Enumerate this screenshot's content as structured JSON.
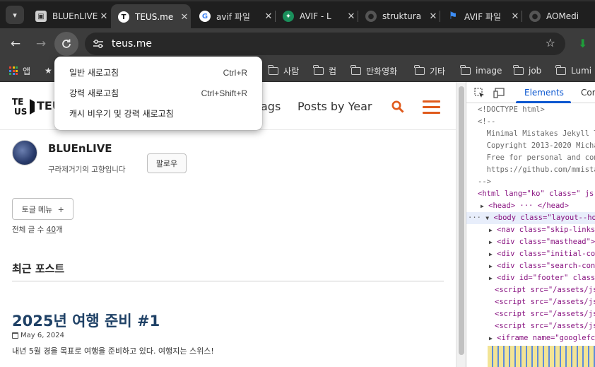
{
  "tabs": [
    {
      "title": "BLUEnLIVE",
      "favicon": "avatar-icon",
      "active": false
    },
    {
      "title": "TEUS.me",
      "favicon": "teus-icon",
      "active": true
    },
    {
      "title": "avif 파일",
      "favicon": "google-icon",
      "active": false
    },
    {
      "title": "AVIF - L",
      "favicon": "ai-icon",
      "active": false
    },
    {
      "title": "struktura",
      "favicon": "github-icon",
      "active": false
    },
    {
      "title": "AVIF 파일",
      "favicon": "flag-icon",
      "active": false
    },
    {
      "title": "AOMedi",
      "favicon": "github-icon",
      "active": false
    }
  ],
  "toolbar": {
    "url": "teus.me"
  },
  "bookmarks": [
    "앱",
    "사람",
    "컴",
    "만화영화",
    "기타",
    "image",
    "job",
    "Lumi"
  ],
  "context_menu": [
    {
      "label": "일반 새로고침",
      "shortcut": "Ctrl+R"
    },
    {
      "label": "강력 새로고침",
      "shortcut": "Ctrl+Shift+R"
    },
    {
      "label": "캐시 비우기 및 강력 새로고침",
      "shortcut": ""
    }
  ],
  "site": {
    "logo_text": "TEUS.me",
    "nav": [
      "ags",
      "Posts by Year"
    ],
    "author_name": "BLUEnLIVE",
    "author_bio": "구라제거기의 고향입니다",
    "follow_label": "팔로우",
    "toggle_label": "토글 메뉴",
    "total_prefix": "전체 글 수 ",
    "total_count": "40",
    "total_suffix": "개",
    "recent_heading": "최근 포스트",
    "post_title": "2025년 여행 준비 #1",
    "post_date": "May 6, 2024",
    "post_excerpt": "내년 5월 경을 목표로 여행을 준비하고 있다. 여행지는 스위스!"
  },
  "devtools": {
    "tabs": [
      "Elements",
      "Cons"
    ],
    "lines": [
      "<!DOCTYPE html>",
      "<!--",
      "  Minimal Mistakes Jekyll Th",
      "  Copyright 2013-2020 Michae",
      "  Free for personal and comm",
      "  https://github.com/mmistak",
      "-->",
      "<html lang=\"ko\" class=\" js \"",
      "<head> ··· </head>",
      "<body class=\"layout--home\"",
      "<nav class=\"skip-links\">",
      "<div class=\"masthead\"> ···",
      "<div class=\"initial-cont",
      "<div class=\"search-conte",
      "<div id=\"footer\" class=\"",
      "<script src=\"/assets/js/",
      "<script src=\"/assets/js/",
      "<script src=\"/assets/js/",
      "<script src=\"/assets/js/",
      "<iframe name=\"googlefcPr"
    ]
  },
  "colors": {
    "accent": "#0b57d0",
    "nav_orange": "#e05a1c",
    "post_title": "#1f4166"
  }
}
